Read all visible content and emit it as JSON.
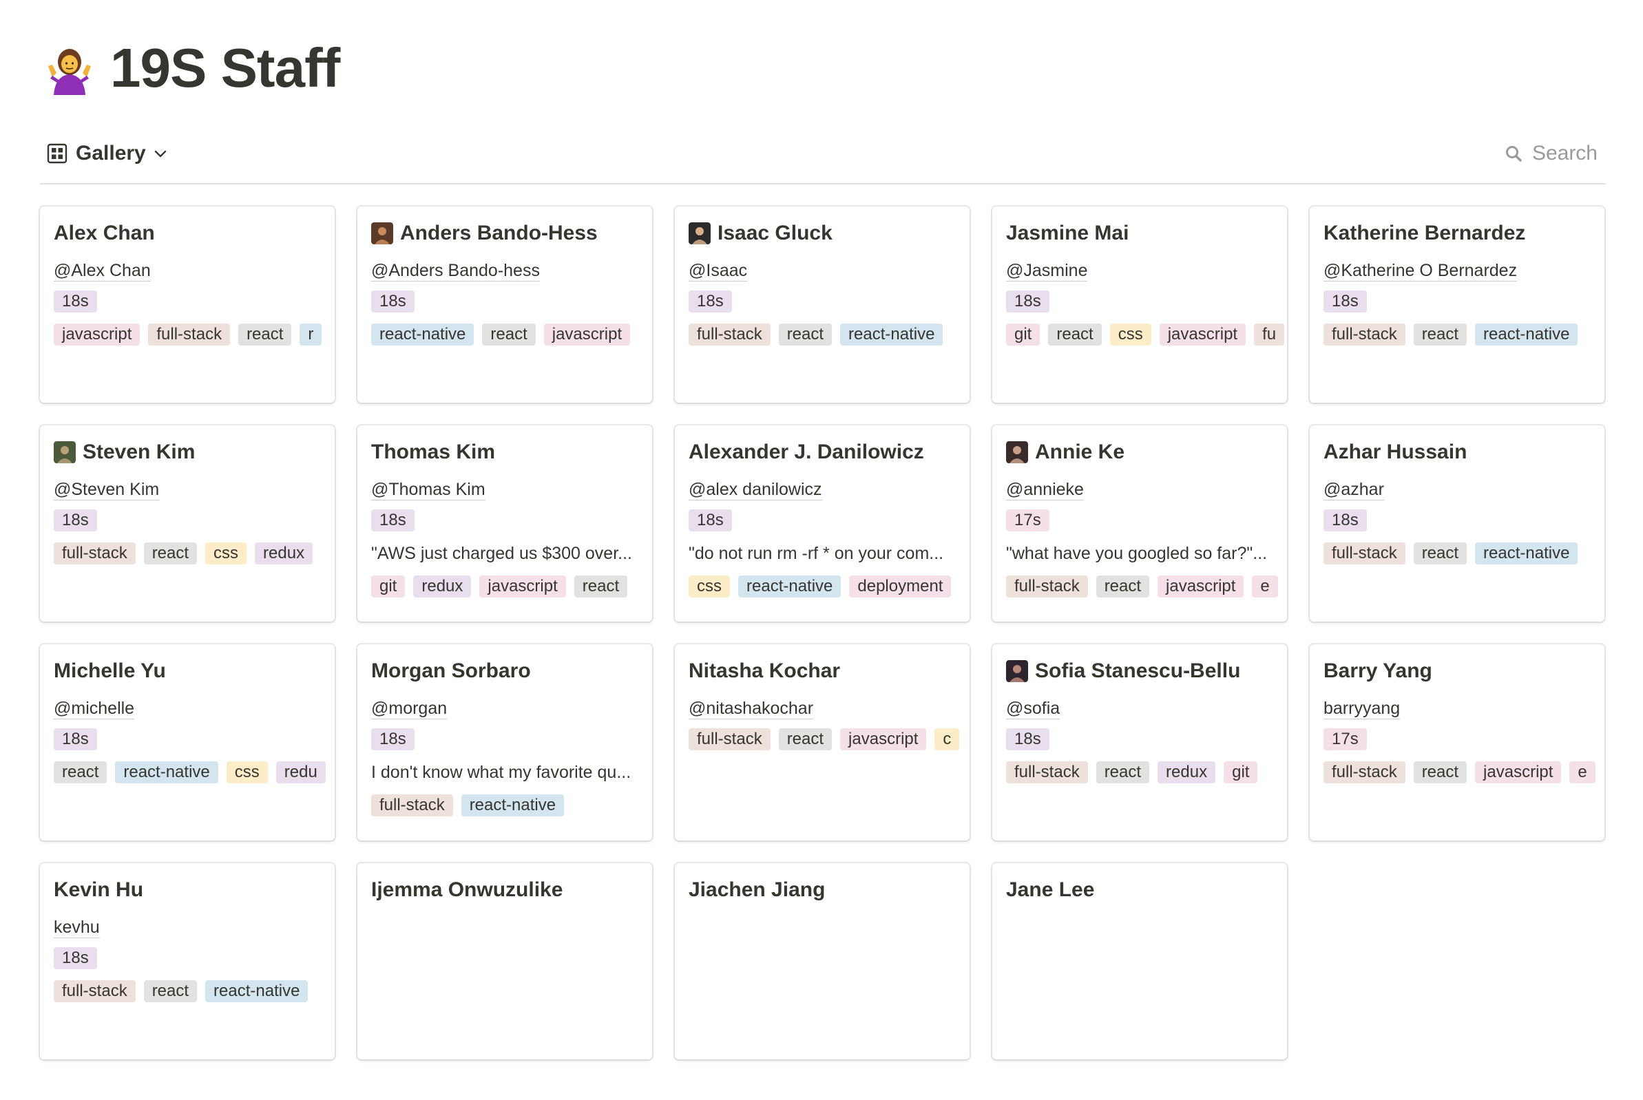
{
  "page": {
    "title": "19S Staff",
    "icon": "person-shrugging-emoji"
  },
  "toolbar": {
    "view_label": "Gallery",
    "view_icon": "gallery-grid-icon",
    "search_label": "Search"
  },
  "tag_colors": {
    "purple": "#e8deee",
    "pink": "#f5e0e9",
    "brown": "#eee0da",
    "gray": "#e3e2e0",
    "blue": "#d3e5ef",
    "yellow": "#fdecc8"
  },
  "cards": [
    {
      "name": "Alex Chan",
      "avatar": null,
      "handle": "@Alex Chan",
      "cohort": {
        "label": "18s",
        "color": "purple"
      },
      "quote": null,
      "tags": [
        {
          "label": "javascript",
          "color": "pink"
        },
        {
          "label": "full-stack",
          "color": "brown"
        },
        {
          "label": "react",
          "color": "gray"
        },
        {
          "label": "r",
          "color": "blue"
        }
      ]
    },
    {
      "name": "Anders Bando-Hess",
      "avatar": "photo",
      "handle": "@Anders Bando-hess",
      "cohort": {
        "label": "18s",
        "color": "purple"
      },
      "quote": null,
      "tags": [
        {
          "label": "react-native",
          "color": "blue"
        },
        {
          "label": "react",
          "color": "gray"
        },
        {
          "label": "javascript",
          "color": "pink"
        }
      ]
    },
    {
      "name": "Isaac Gluck",
      "avatar": "photo",
      "handle": "@Isaac",
      "cohort": {
        "label": "18s",
        "color": "purple"
      },
      "quote": null,
      "tags": [
        {
          "label": "full-stack",
          "color": "brown"
        },
        {
          "label": "react",
          "color": "gray"
        },
        {
          "label": "react-native",
          "color": "blue"
        }
      ]
    },
    {
      "name": "Jasmine Mai",
      "avatar": null,
      "handle": "@Jasmine",
      "cohort": {
        "label": "18s",
        "color": "purple"
      },
      "quote": null,
      "tags": [
        {
          "label": "git",
          "color": "pink"
        },
        {
          "label": "react",
          "color": "gray"
        },
        {
          "label": "css",
          "color": "yellow"
        },
        {
          "label": "javascript",
          "color": "pink"
        },
        {
          "label": "fu",
          "color": "brown"
        }
      ]
    },
    {
      "name": "Katherine Bernardez",
      "avatar": null,
      "handle": "@Katherine O Bernardez",
      "cohort": {
        "label": "18s",
        "color": "purple"
      },
      "quote": null,
      "tags": [
        {
          "label": "full-stack",
          "color": "brown"
        },
        {
          "label": "react",
          "color": "gray"
        },
        {
          "label": "react-native",
          "color": "blue"
        }
      ]
    },
    {
      "name": "Steven Kim",
      "avatar": "photo",
      "handle": "@Steven Kim",
      "cohort": {
        "label": "18s",
        "color": "purple"
      },
      "quote": null,
      "tags": [
        {
          "label": "full-stack",
          "color": "brown"
        },
        {
          "label": "react",
          "color": "gray"
        },
        {
          "label": "css",
          "color": "yellow"
        },
        {
          "label": "redux",
          "color": "purple"
        }
      ]
    },
    {
      "name": "Thomas Kim",
      "avatar": null,
      "handle": "@Thomas Kim",
      "cohort": {
        "label": "18s",
        "color": "purple"
      },
      "quote": "\"AWS just charged us $300 over...",
      "tags": [
        {
          "label": "git",
          "color": "pink"
        },
        {
          "label": "redux",
          "color": "purple"
        },
        {
          "label": "javascript",
          "color": "pink"
        },
        {
          "label": "react",
          "color": "gray"
        }
      ]
    },
    {
      "name": "Alexander J. Danilowicz",
      "avatar": null,
      "handle": "@alex danilowicz",
      "cohort": {
        "label": "18s",
        "color": "purple"
      },
      "quote": "\"do not run rm -rf * on your com...",
      "tags": [
        {
          "label": "css",
          "color": "yellow"
        },
        {
          "label": "react-native",
          "color": "blue"
        },
        {
          "label": "deployment",
          "color": "pink"
        }
      ]
    },
    {
      "name": "Annie Ke",
      "avatar": "photo",
      "handle": "@annieke",
      "cohort": {
        "label": "17s",
        "color": "pink"
      },
      "quote": "\"what have you googled so far?\"...",
      "tags": [
        {
          "label": "full-stack",
          "color": "brown"
        },
        {
          "label": "react",
          "color": "gray"
        },
        {
          "label": "javascript",
          "color": "pink"
        },
        {
          "label": "e",
          "color": "pink"
        }
      ]
    },
    {
      "name": "Azhar Hussain",
      "avatar": null,
      "handle": "@azhar",
      "cohort": {
        "label": "18s",
        "color": "purple"
      },
      "quote": null,
      "tags": [
        {
          "label": "full-stack",
          "color": "brown"
        },
        {
          "label": "react",
          "color": "gray"
        },
        {
          "label": "react-native",
          "color": "blue"
        }
      ]
    },
    {
      "name": "Michelle Yu",
      "avatar": null,
      "handle": "@michelle",
      "cohort": {
        "label": "18s",
        "color": "purple"
      },
      "quote": null,
      "tags": [
        {
          "label": "react",
          "color": "gray"
        },
        {
          "label": "react-native",
          "color": "blue"
        },
        {
          "label": "css",
          "color": "yellow"
        },
        {
          "label": "redu",
          "color": "purple"
        }
      ]
    },
    {
      "name": "Morgan Sorbaro",
      "avatar": null,
      "handle": "@morgan",
      "cohort": {
        "label": "18s",
        "color": "purple"
      },
      "quote": "I don't know what my favorite qu...",
      "tags": [
        {
          "label": "full-stack",
          "color": "brown"
        },
        {
          "label": "react-native",
          "color": "blue"
        }
      ]
    },
    {
      "name": "Nitasha Kochar",
      "avatar": null,
      "handle": "@nitashakochar",
      "cohort": null,
      "quote": null,
      "tags": [
        {
          "label": "full-stack",
          "color": "brown"
        },
        {
          "label": "react",
          "color": "gray"
        },
        {
          "label": "javascript",
          "color": "pink"
        },
        {
          "label": "c",
          "color": "yellow"
        }
      ]
    },
    {
      "name": "Sofia Stanescu-Bellu",
      "avatar": "photo",
      "handle": "@sofia",
      "cohort": {
        "label": "18s",
        "color": "purple"
      },
      "quote": null,
      "tags": [
        {
          "label": "full-stack",
          "color": "brown"
        },
        {
          "label": "react",
          "color": "gray"
        },
        {
          "label": "redux",
          "color": "purple"
        },
        {
          "label": "git",
          "color": "pink"
        }
      ]
    },
    {
      "name": "Barry Yang",
      "avatar": null,
      "handle": "barryyang",
      "cohort": {
        "label": "17s",
        "color": "pink"
      },
      "quote": null,
      "tags": [
        {
          "label": "full-stack",
          "color": "brown"
        },
        {
          "label": "react",
          "color": "gray"
        },
        {
          "label": "javascript",
          "color": "pink"
        },
        {
          "label": "e",
          "color": "pink"
        }
      ]
    },
    {
      "name": "Kevin Hu",
      "avatar": null,
      "handle": "kevhu",
      "cohort": {
        "label": "18s",
        "color": "purple"
      },
      "quote": null,
      "tags": [
        {
          "label": "full-stack",
          "color": "brown"
        },
        {
          "label": "react",
          "color": "gray"
        },
        {
          "label": "react-native",
          "color": "blue"
        }
      ]
    },
    {
      "name": "Ijemma Onwuzulike",
      "avatar": null,
      "handle": null,
      "cohort": null,
      "quote": null,
      "tags": []
    },
    {
      "name": "Jiachen Jiang",
      "avatar": null,
      "handle": null,
      "cohort": null,
      "quote": null,
      "tags": []
    },
    {
      "name": "Jane Lee",
      "avatar": null,
      "handle": null,
      "cohort": null,
      "quote": null,
      "tags": []
    }
  ]
}
